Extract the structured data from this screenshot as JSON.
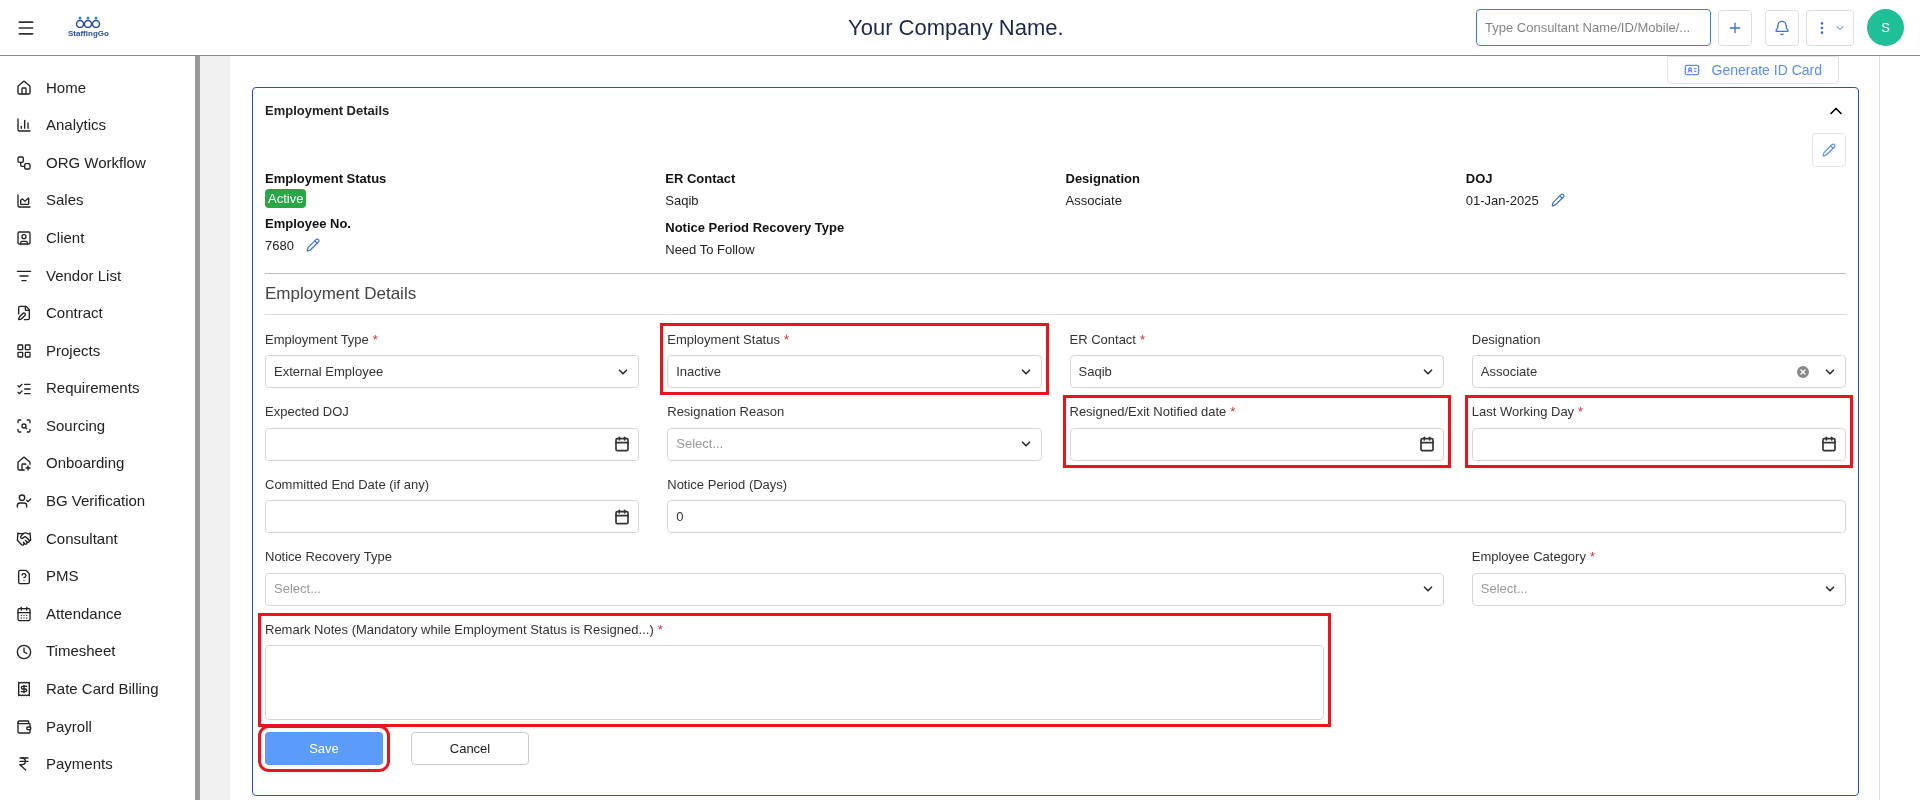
{
  "header": {
    "logo_text": "StaffingGo",
    "company": "Your Company Name.",
    "search": {
      "placeholder": "Type Consultant Name/ID/Mobile/..."
    },
    "avatar": "S"
  },
  "sidebar": {
    "items": [
      {
        "label": "Home"
      },
      {
        "label": "Analytics"
      },
      {
        "label": "ORG Workflow"
      },
      {
        "label": "Sales"
      },
      {
        "label": "Client"
      },
      {
        "label": "Vendor List"
      },
      {
        "label": "Contract"
      },
      {
        "label": "Projects"
      },
      {
        "label": "Requirements"
      },
      {
        "label": "Sourcing"
      },
      {
        "label": "Onboarding"
      },
      {
        "label": "BG Verification"
      },
      {
        "label": "Consultant"
      },
      {
        "label": "PMS"
      },
      {
        "label": "Attendance"
      },
      {
        "label": "Timesheet"
      },
      {
        "label": "Rate Card Billing"
      },
      {
        "label": "Payroll"
      },
      {
        "label": "Payments"
      }
    ]
  },
  "generate_button": "Generate ID Card",
  "card": {
    "title": "Employment Details",
    "expanded": true,
    "info": [
      [
        {
          "label": "Employment Status",
          "value": "Active",
          "kind": "badge",
          "editable": false
        },
        {
          "label": "Employee No.",
          "value": "7680",
          "kind": "text",
          "editable": true
        }
      ],
      [
        {
          "label": "ER Contact",
          "value": "Saqib",
          "kind": "text",
          "editable": false
        },
        {
          "label": "Notice Period Recovery Type",
          "value": "Need To Follow",
          "kind": "text",
          "editable": false
        }
      ],
      [
        {
          "label": "Designation",
          "value": "Associate",
          "kind": "text",
          "editable": false
        }
      ],
      [
        {
          "label": "DOJ",
          "value": "01-Jan-2025",
          "kind": "text",
          "editable": true
        }
      ]
    ],
    "form_title": "Employment Details",
    "fields": [
      {
        "label": "Employment Type",
        "required_mark": "*",
        "kind": "select",
        "value": "External Employee",
        "highlighted": false
      },
      {
        "label": "Employment Status",
        "required_mark": "*",
        "kind": "select",
        "value": "Inactive",
        "highlighted": true
      },
      {
        "label": "ER Contact",
        "required_mark": "*",
        "kind": "select",
        "value": "Saqib",
        "highlighted": false
      },
      {
        "label": "Designation",
        "kind": "select",
        "value": "Associate",
        "clearable": true,
        "highlighted": false
      },
      {
        "label": "Expected DOJ",
        "kind": "date",
        "highlighted": false
      },
      {
        "label": "Resignation Reason",
        "kind": "select",
        "placeholder": "Select...",
        "highlighted": false
      },
      {
        "label": "Resigned/Exit Notified date",
        "required_mark": "*",
        "kind": "date",
        "highlighted": true
      },
      {
        "label": "Last Working Day",
        "required_mark": "*",
        "kind": "date",
        "highlighted": true
      },
      {
        "label": "Committed End Date (if any)",
        "kind": "date",
        "highlighted": false
      },
      {
        "label": "Notice Period (Days)",
        "kind": "text",
        "value": "0",
        "highlighted": false
      },
      {
        "label": "Notice Recovery Type",
        "kind": "select",
        "placeholder": "Select...",
        "highlighted": false
      },
      {
        "label": "Employee Category",
        "required_mark": "*",
        "kind": "select",
        "placeholder": "Select...",
        "highlighted": false
      },
      {
        "label": "Remark Notes (Mandatory while Employment Status is Resigned...)",
        "required_mark": "*",
        "kind": "textarea",
        "highlighted": true
      }
    ],
    "buttons": [
      {
        "label": "Save",
        "kind": "primary",
        "highlighted": true
      },
      {
        "label": "Cancel",
        "kind": "secondary",
        "highlighted": false
      }
    ]
  }
}
